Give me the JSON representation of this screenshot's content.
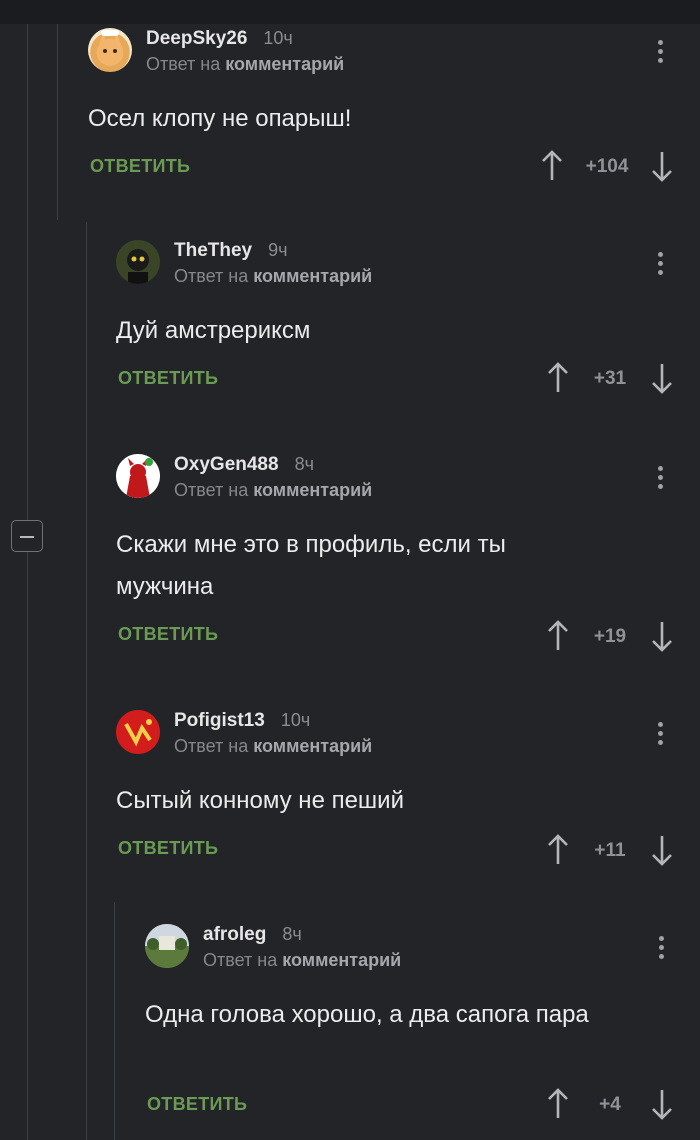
{
  "reply_to_prefix": "Ответ на",
  "reply_to_target": "комментарий",
  "reply_label": "ОТВЕТИТЬ",
  "comments": [
    {
      "user": "DeepSky26",
      "time": "10ч",
      "text": "Осел клопу не опарыш!",
      "score": "+104",
      "avatar": "cat-avatar"
    },
    {
      "user": "TheThey",
      "time": "9ч",
      "text": "Дуй амстрериксм",
      "score": "+31",
      "avatar": "dark-character-avatar"
    },
    {
      "user": "OxyGen488",
      "time": "8ч",
      "text": "Скажи мне это в профиль, если ты мужчина",
      "score": "+19",
      "avatar": "devil-avatar"
    },
    {
      "user": "Pofigist13",
      "time": "10ч",
      "text": "Сытый конному не пеший",
      "score": "+11",
      "avatar": "red-logo-avatar"
    },
    {
      "user": "afroleg",
      "time": "8ч",
      "text": "Одна голова хорошо, а два сапога пара",
      "score": "+4",
      "avatar": "landscape-avatar"
    }
  ]
}
